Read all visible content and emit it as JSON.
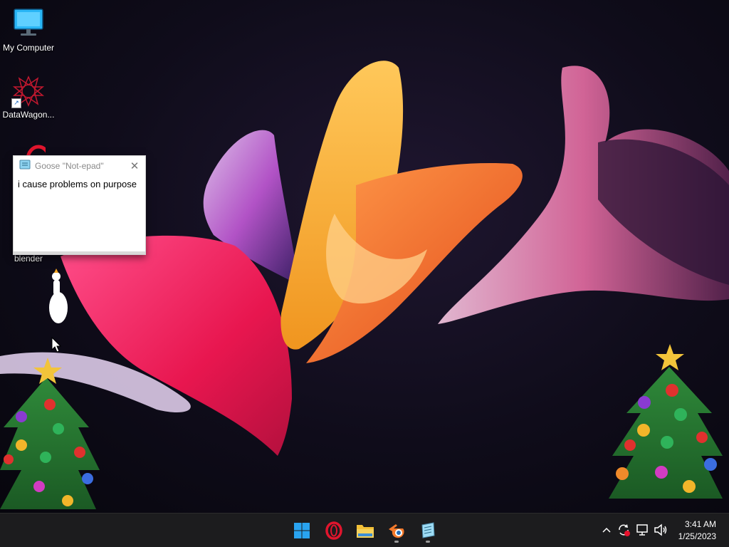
{
  "desktop": {
    "icons": [
      {
        "label": "My Computer",
        "icon": "monitor-icon"
      },
      {
        "label": "DataWagon...",
        "icon": "datawagon-icon"
      },
      {
        "label": "",
        "icon": "opera-icon"
      },
      {
        "label": "blender",
        "icon": "blender-icon"
      }
    ]
  },
  "notepad": {
    "title": "Goose \"Not-epad\"",
    "text": "i cause problems on purpose",
    "close_icon": "close-icon"
  },
  "taskbar": {
    "apps": [
      {
        "name": "Start",
        "icon": "windows-start-icon"
      },
      {
        "name": "Opera",
        "icon": "opera-icon"
      },
      {
        "name": "File Explorer",
        "icon": "folder-icon"
      },
      {
        "name": "Blender",
        "icon": "blender-icon"
      },
      {
        "name": "Notepad",
        "icon": "notepad-icon"
      }
    ],
    "tray": {
      "icons": [
        "chevron-up-icon",
        "sync-icon",
        "network-icon",
        "volume-icon"
      ]
    },
    "clock": {
      "time": "3:41 AM",
      "date": "1/25/2023"
    }
  },
  "colors": {
    "taskbar_bg": "#1c1c1e",
    "desktop_bg": "#0f0c1a",
    "start_blue": "#29a3f0",
    "opera_red": "#e0152d",
    "folder_yellow": "#f2c037",
    "blender_orange": "#f5792a"
  }
}
